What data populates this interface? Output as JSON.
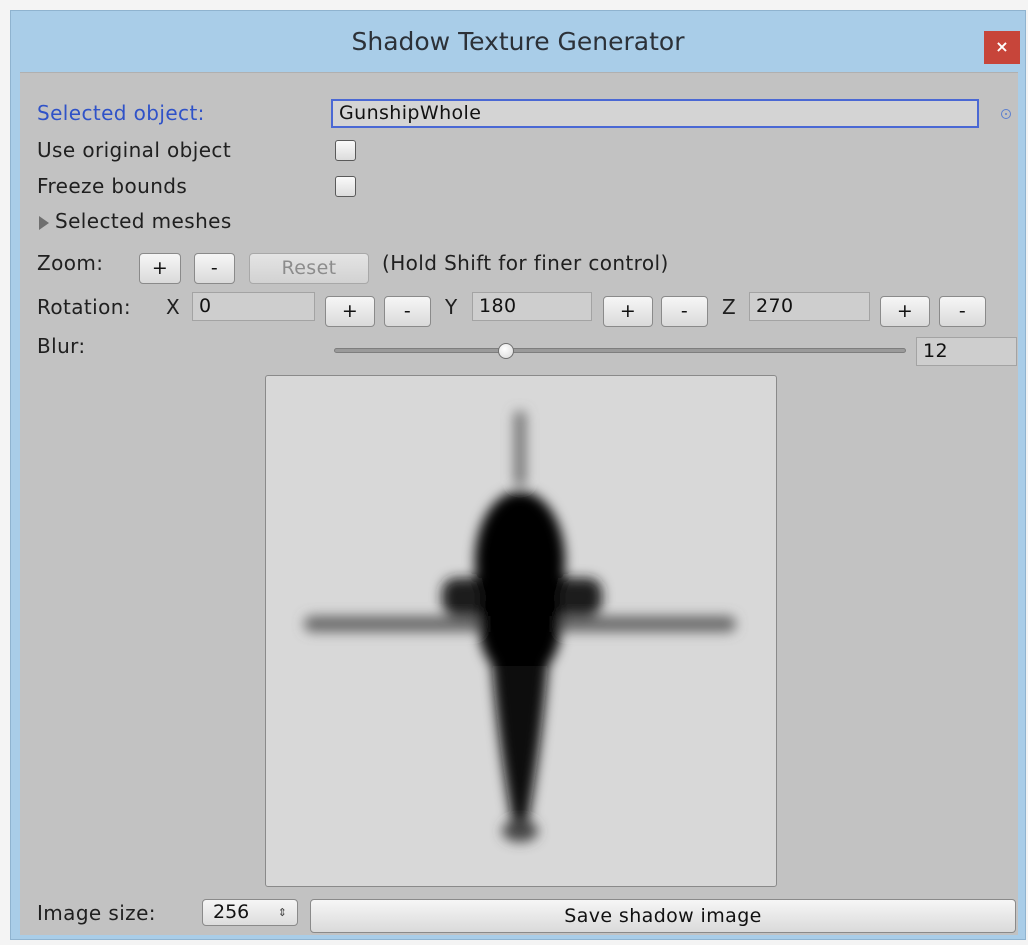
{
  "window": {
    "title": "Shadow Texture Generator",
    "close_label": "×"
  },
  "selected_object": {
    "label": "Selected object:",
    "value": "GunshipWhole"
  },
  "use_original": {
    "label": "Use original object",
    "checked": false
  },
  "freeze_bounds": {
    "label": "Freeze bounds",
    "checked": false
  },
  "selected_meshes": {
    "label": "Selected meshes",
    "expanded": false
  },
  "zoom": {
    "label": "Zoom:",
    "plus_label": "+",
    "minus_label": "-",
    "reset_label": "Reset",
    "hint": "(Hold Shift for finer control)"
  },
  "rotation": {
    "label": "Rotation:",
    "x_label": "X",
    "x_value": "0",
    "y_label": "Y",
    "y_value": "180",
    "z_label": "Z",
    "z_value": "270",
    "plus_label": "+",
    "minus_label": "-"
  },
  "blur": {
    "label": "Blur:",
    "value": "12",
    "level": 0.3
  },
  "image_size": {
    "label": "Image size:",
    "selected": "256"
  },
  "save_button": {
    "label": "Save shadow image"
  },
  "colors": {
    "title_bar": "#a9cde8",
    "close_button": "#c7453a",
    "panel": "#c2c2c2",
    "label_accent": "#2f52c8",
    "shadow": "#000000"
  }
}
